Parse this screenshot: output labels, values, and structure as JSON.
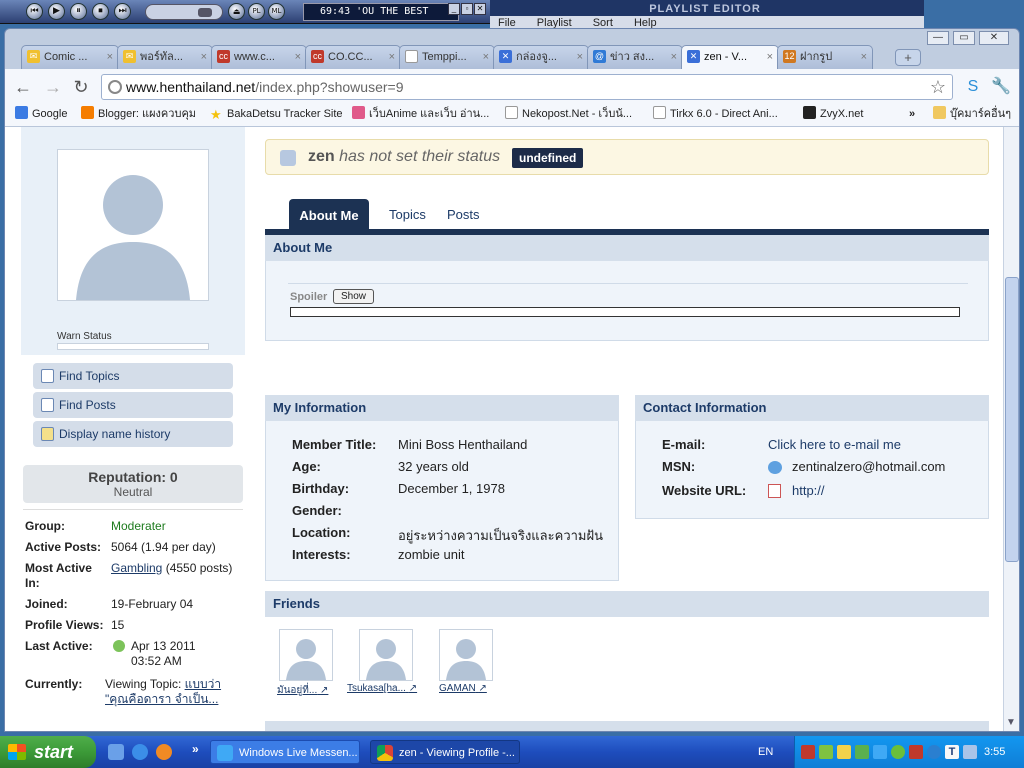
{
  "winamp": {
    "lcd_text": "69:43  'OU THE BEST",
    "buttons": [
      "⏮",
      "▶",
      "⏸",
      "⏹",
      "⏭"
    ],
    "small_buttons": [
      "PL",
      "ML"
    ]
  },
  "playlist_editor": {
    "title": "PLAYLIST EDITOR",
    "menu": [
      "File",
      "Playlist",
      "Sort",
      "Help"
    ]
  },
  "browser": {
    "tabs": [
      {
        "label": "Comic ...",
        "icon": "mail-icon",
        "color": "#f0c030"
      },
      {
        "label": "พอร์ทัล...",
        "icon": "mail-icon",
        "color": "#f0c030"
      },
      {
        "label": "www.c...",
        "icon": "cc-icon",
        "color": "#c0392b"
      },
      {
        "label": "CO.CC...",
        "icon": "cc-icon",
        "color": "#c0392b"
      },
      {
        "label": "Temppi...",
        "icon": "page-icon",
        "color": "#ffffff"
      },
      {
        "label": "กล่องจู...",
        "icon": "tracker-icon",
        "color": "#3a6fd8"
      },
      {
        "label": "ข่าว สง...",
        "icon": "at-icon",
        "color": "#2f7ad6"
      },
      {
        "label": "zen - V...",
        "icon": "tracker-icon",
        "color": "#3a6fd8"
      },
      {
        "label": "ฝากรูป",
        "icon": "photo-icon",
        "color": "#d07820"
      }
    ],
    "active_tab": 7,
    "url_host": "www.henthailand.net",
    "url_path": "/index.php?showuser=9",
    "bookmarks": [
      {
        "label": "Google",
        "icon": "google-icon",
        "color": "#3b7be3"
      },
      {
        "label": "Blogger: แผงควบคุม",
        "icon": "blogger-icon",
        "color": "#f57d00"
      },
      {
        "label": "BakaDetsu Tracker Site",
        "icon": "star-icon",
        "color": "#f4c20d"
      },
      {
        "label": "เว็บAnime และเว็บ อ่าน...",
        "icon": "anime-icon",
        "color": "#e05a8a"
      },
      {
        "label": "Nekopost.Net - เว็บน้...",
        "icon": "page-icon",
        "color": "#ffffff"
      },
      {
        "label": "Tirkx 6.0 - Direct Ani...",
        "icon": "page-icon",
        "color": "#ffffff"
      },
      {
        "label": "ZvyX.net",
        "icon": "zvyx-icon",
        "color": "#222222"
      }
    ],
    "other_bookmarks": "บุ๊คมาร์คอื่นๆ",
    "overflow": "»"
  },
  "profile": {
    "warn_status_label": "Warn Status",
    "side_links": [
      "Find Topics",
      "Find Posts",
      "Display name history"
    ],
    "reputation_title": "Reputation: 0",
    "reputation_sub": "Neutral",
    "stats": {
      "group_label": "Group:",
      "group_value": "Moderater",
      "posts_label": "Active Posts:",
      "posts_value": "5064 (1.94 per day)",
      "most_label": "Most Active In:",
      "most_link": "Gambling",
      "most_rest": " (4550 posts)",
      "joined_label": "Joined:",
      "joined_value": "19-February 04",
      "views_label": "Profile Views:",
      "views_value": "15",
      "last_label": "Last Active:",
      "last_value": "Apr 13 2011 03:52 AM",
      "current_label": "Currently:",
      "current_prefix": "Viewing Topic: ",
      "current_link": "แบบว่า \"คุณคือดารา จำเป็น..."
    },
    "status": {
      "name": "zen",
      "text": " has not set their status",
      "badge": "undefined"
    },
    "tabs": {
      "about": "About Me",
      "topics": "Topics",
      "posts": "Posts"
    },
    "about_me": {
      "heading": "About Me",
      "spoiler_label": "Spoiler",
      "spoiler_button": "Show"
    },
    "my_information": {
      "heading": "My Information",
      "rows": [
        {
          "label": "Member Title:",
          "value": "Mini Boss Henthailand"
        },
        {
          "label": "Age:",
          "value": "32 years old"
        },
        {
          "label": "Birthday:",
          "value": "December 1, 1978"
        },
        {
          "label": "Gender:",
          "value": ""
        },
        {
          "label": "Location:",
          "value": "อยู่ระหว่างความเป็นจริงและความฝัน"
        },
        {
          "label": "Interests:",
          "value": "zombie unit"
        }
      ]
    },
    "contact_information": {
      "heading": "Contact Information",
      "email_label": "E-mail:",
      "email_value": "Click here to e-mail me",
      "msn_label": "MSN:",
      "msn_value": "zentinalzero@hotmail.com",
      "website_label": "Website URL:",
      "website_value": "http://"
    },
    "friends": {
      "heading": "Friends",
      "items": [
        "มันอยู่ที่...",
        "Tsukasa[ha...",
        "GAMAN"
      ]
    }
  },
  "taskbar": {
    "start": "start",
    "tasks": [
      {
        "label": "Windows Live Messen...",
        "icon": "messenger-icon"
      },
      {
        "label": "zen - Viewing Profile -...",
        "icon": "chrome-icon"
      }
    ],
    "language": "EN",
    "clock": "3:55",
    "quicklaunch_overflow": "»"
  }
}
